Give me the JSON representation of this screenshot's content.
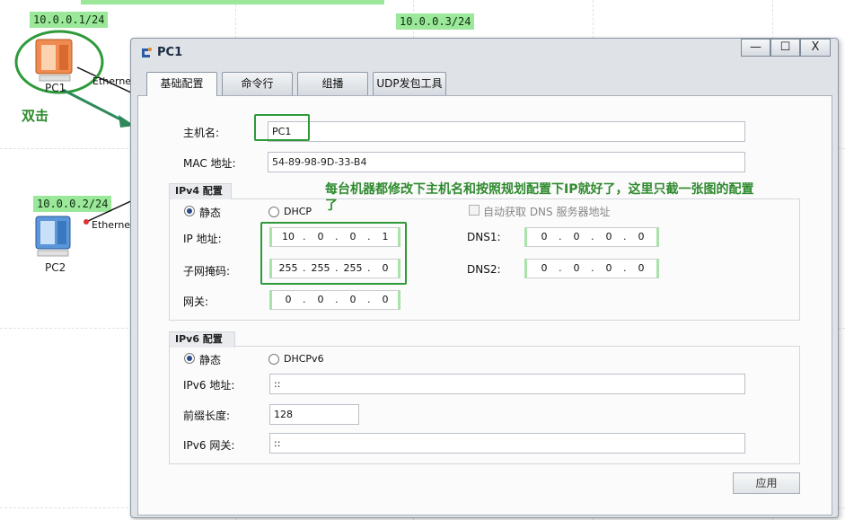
{
  "topology": {
    "ip_labels": [
      "10.0.0.1/24",
      "10.0.0.3/24",
      "10.0.0.2/24"
    ],
    "nodes": [
      "PC1",
      "PC2"
    ],
    "port_label": "Ethernet",
    "double_click_note": "双击"
  },
  "window": {
    "title": "PC1",
    "controls": {
      "minimize": "—",
      "maximize": "☐",
      "close": "X"
    }
  },
  "tabs": [
    "基础配置",
    "命令行",
    "组播",
    "UDP发包工具"
  ],
  "basic": {
    "hostname_label": "主机名:",
    "hostname_value": "PC1",
    "mac_label": "MAC 地址:",
    "mac_value": "54-89-98-9D-33-B4"
  },
  "ipv4": {
    "title": "IPv4 配置",
    "static_label": "静态",
    "dhcp_label": "DHCP",
    "auto_dns_label": "自动获取 DNS 服务器地址",
    "ip_label": "IP 地址:",
    "ip": [
      "10",
      "0",
      "0",
      "1"
    ],
    "mask_label": "子网掩码:",
    "mask": [
      "255",
      "255",
      "255",
      "0"
    ],
    "gateway_label": "网关:",
    "gateway": [
      "0",
      "0",
      "0",
      "0"
    ],
    "dns1_label": "DNS1:",
    "dns1": [
      "0",
      "0",
      "0",
      "0"
    ],
    "dns2_label": "DNS2:",
    "dns2": [
      "0",
      "0",
      "0",
      "0"
    ],
    "mode": "static",
    "auto_dns": false
  },
  "ipv6": {
    "title": "IPv6 配置",
    "static_label": "静态",
    "dhcp_label": "DHCPv6",
    "addr_label": "IPv6 地址:",
    "addr_value": "::",
    "prefix_label": "前缀长度:",
    "prefix_value": "128",
    "gateway_label": "IPv6 网关:",
    "gateway_value": "::",
    "mode": "static"
  },
  "annotation": "每台机器都修改下主机名和按照规划配置下IP就好了，这里只截一张图的配置了",
  "apply_label": "应用",
  "colors": {
    "highlight_green": "#2e9a3a",
    "label_green": "#9be89b",
    "annotation_green": "#2e8a2e"
  }
}
